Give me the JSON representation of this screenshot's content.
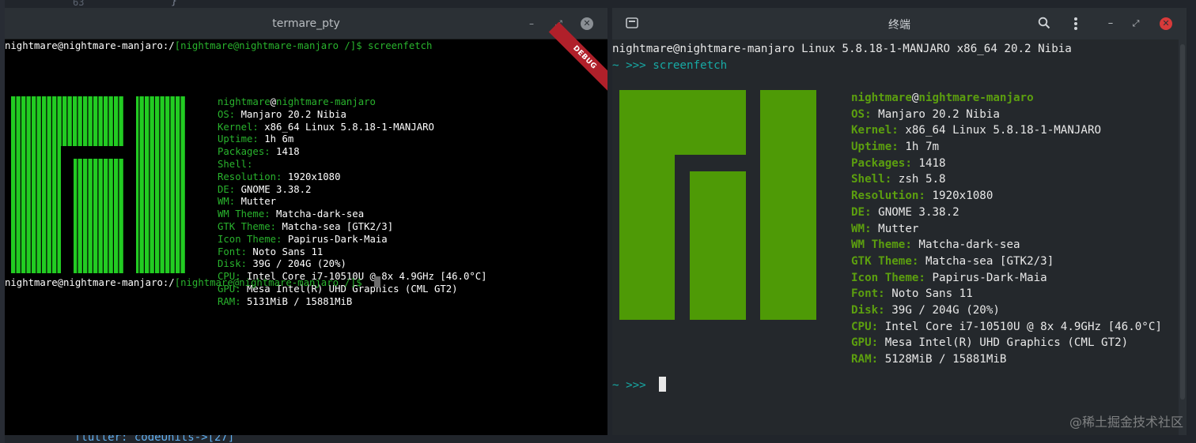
{
  "background_editor": {
    "line_number": "63",
    "top_code": "}",
    "bottom_code": "flutter: codeUnits->[27]"
  },
  "left_window": {
    "title": "termare_pty",
    "debug_badge": "DEBUG",
    "prompt_user_host": "nightmare@nightmare-manjaro:/",
    "prompt_bracket": "[nightmare@nightmare-manjaro /]$ ",
    "command": "screenfetch",
    "userhost_user": "nightmare",
    "userhost_at": "@",
    "userhost_host": "nightmare-manjaro",
    "info": [
      {
        "key": "OS: ",
        "value": "Manjaro 20.2 Nibia"
      },
      {
        "key": "Kernel: ",
        "value": "x86_64 Linux 5.8.18-1-MANJARO"
      },
      {
        "key": "Uptime: ",
        "value": "1h 6m"
      },
      {
        "key": "Packages: ",
        "value": "1418"
      },
      {
        "key": "Shell: ",
        "value": ""
      },
      {
        "key": "Resolution: ",
        "value": "1920x1080"
      },
      {
        "key": "DE: ",
        "value": "GNOME 3.38.2"
      },
      {
        "key": "WM: ",
        "value": "Mutter"
      },
      {
        "key": "WM Theme: ",
        "value": "Matcha-dark-sea"
      },
      {
        "key": "GTK Theme: ",
        "value": "Matcha-sea [GTK2/3]"
      },
      {
        "key": "Icon Theme: ",
        "value": "Papirus-Dark-Maia"
      },
      {
        "key": "Font: ",
        "value": "Noto Sans 11"
      },
      {
        "key": "Disk: ",
        "value": "39G / 204G (20%)"
      },
      {
        "key": "CPU: ",
        "value": "Intel Core i7-10510U @ 8x 4.9GHz [46.0°C]"
      },
      {
        "key": "GPU: ",
        "value": "Mesa Intel(R) UHD Graphics (CML GT2)"
      },
      {
        "key": "RAM: ",
        "value": "5131MiB / 15881MiB"
      }
    ],
    "logo_color": "#22cc22"
  },
  "right_window": {
    "title": "终端",
    "header_line": "nightmare@nightmare-manjaro Linux 5.8.18-1-MANJARO x86_64 20.2 Nibia",
    "prompt_tilde": "~ ",
    "prompt_arrows": ">>> ",
    "command": "screenfetch",
    "userhost_user": "nightmare",
    "userhost_at": "@",
    "userhost_host": "nightmare-manjaro",
    "info": [
      {
        "key": "OS: ",
        "value": "Manjaro 20.2 Nibia"
      },
      {
        "key": "Kernel: ",
        "value": "x86_64 Linux 5.8.18-1-MANJARO"
      },
      {
        "key": "Uptime: ",
        "value": "1h 7m"
      },
      {
        "key": "Packages: ",
        "value": "1418"
      },
      {
        "key": "Shell: ",
        "value": "zsh 5.8"
      },
      {
        "key": "Resolution: ",
        "value": "1920x1080"
      },
      {
        "key": "DE: ",
        "value": "GNOME 3.38.2"
      },
      {
        "key": "WM: ",
        "value": "Mutter"
      },
      {
        "key": "WM Theme: ",
        "value": "Matcha-dark-sea"
      },
      {
        "key": "GTK Theme: ",
        "value": "Matcha-sea [GTK2/3]"
      },
      {
        "key": "Icon Theme: ",
        "value": "Papirus-Dark-Maia"
      },
      {
        "key": "Font: ",
        "value": "Noto Sans 11"
      },
      {
        "key": "Disk: ",
        "value": "39G / 204G (20%)"
      },
      {
        "key": "CPU: ",
        "value": "Intel Core i7-10510U @ 8x 4.9GHz [46.0°C]"
      },
      {
        "key": "GPU: ",
        "value": "Mesa Intel(R) UHD Graphics (CML GT2)"
      },
      {
        "key": "RAM: ",
        "value": "5128MiB / 15881MiB"
      }
    ],
    "logo_color": "#4e9a06"
  },
  "watermark": "@稀土掘金技术社区"
}
